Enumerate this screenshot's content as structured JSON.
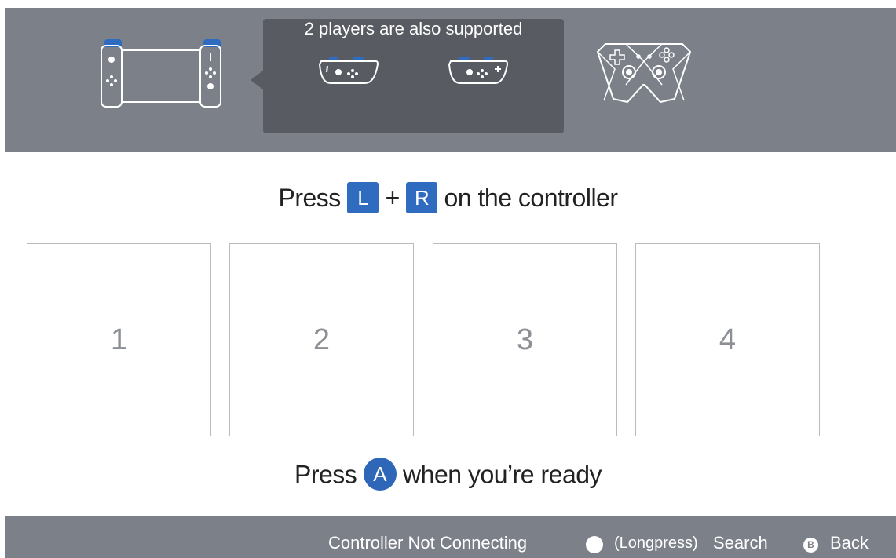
{
  "header": {
    "tooltip_text": "2 players are also supported",
    "icons": [
      "handheld-console-icon",
      "sideways-joycon-left-icon",
      "sideways-joycon-right-icon",
      "pro-controller-icon"
    ]
  },
  "main": {
    "prompt_lr": {
      "before": "Press",
      "key_l": "L",
      "plus": "+",
      "key_r": "R",
      "after": "on the controller"
    },
    "slots": [
      "1",
      "2",
      "3",
      "4"
    ],
    "prompt_ready": {
      "before": "Press",
      "key_a": "A",
      "after": "when you’re ready"
    }
  },
  "footer": {
    "not_connecting": "Controller Not Connecting",
    "longpress": "(Longpress)",
    "search": "Search",
    "back_key": "B",
    "back": "Back"
  },
  "colors": {
    "band": "#7c8089",
    "tooltip": "#585c62",
    "accent": "#2f6cbf"
  }
}
